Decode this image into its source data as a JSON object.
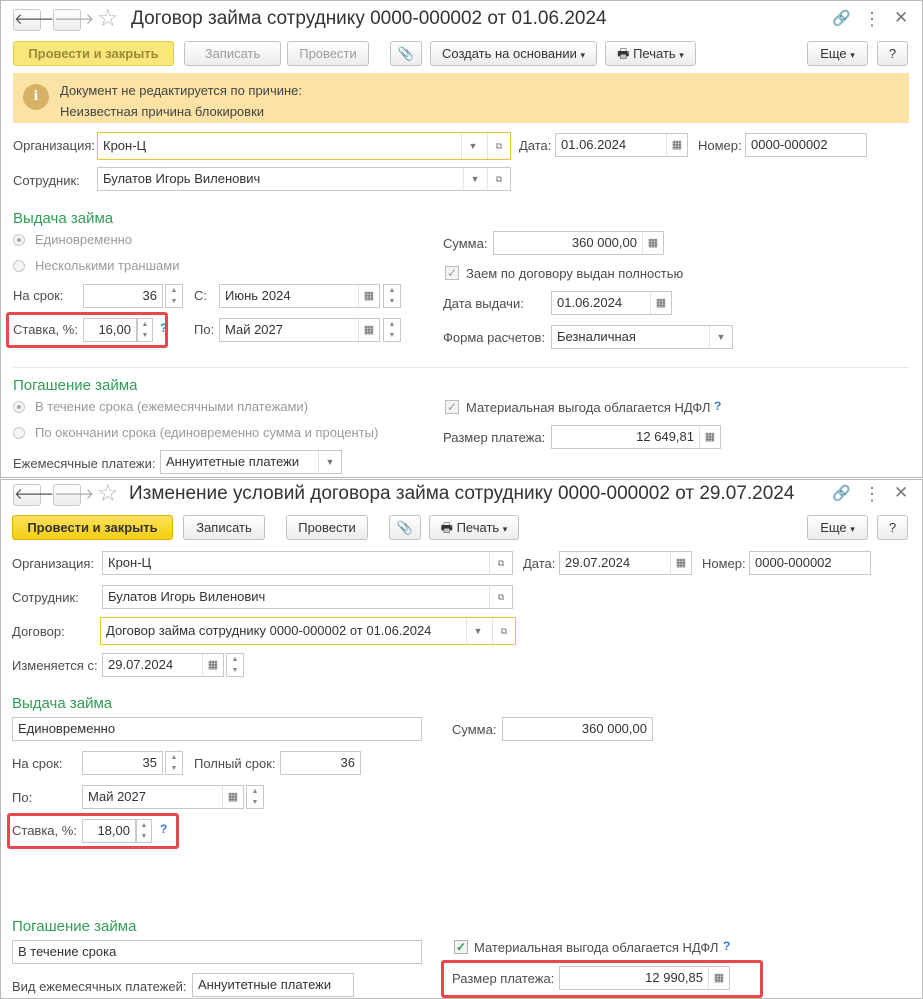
{
  "w1": {
    "title": "Договор займа сотруднику 0000-000002 от 01.06.2024",
    "nav_back": "🡐",
    "nav_fwd": "🡒",
    "toolbar": {
      "post_close": "Провести и закрыть",
      "save": "Записать",
      "post": "Провести",
      "create_based": "Создать на основании",
      "print": "Печать",
      "more": "Еще",
      "help": "?"
    },
    "banner": {
      "line1": "Документ не редактируется по причине:",
      "line2": "Неизвестная причина блокировки"
    },
    "org_label": "Организация:",
    "org_value": "Крон-Ц",
    "date_label": "Дата:",
    "date_value": "01.06.2024",
    "number_label": "Номер:",
    "number_value": "0000-000002",
    "employee_label": "Сотрудник:",
    "employee_value": "Булатов Игорь Виленович",
    "issue_section": "Выдача займа",
    "radio_once": "Единовременно",
    "radio_tranches": "Несколькими траншами",
    "term_label": "На срок:",
    "term_value": "36",
    "from_label": "С:",
    "from_value": "Июнь 2024",
    "to_label": "По:",
    "to_value": "Май 2027",
    "rate_label": "Ставка, %:",
    "rate_value": "16,00",
    "help_q": "?",
    "sum_label": "Сумма:",
    "sum_value": "360 000,00",
    "fully_issued": "Заем по договору выдан полностью",
    "issue_date_label": "Дата выдачи:",
    "issue_date_value": "01.06.2024",
    "payment_form_label": "Форма расчетов:",
    "payment_form_value": "Безналичная",
    "repay_section": "Погашение займа",
    "radio_monthly": "В течение срока (ежемесячными платежами)",
    "radio_end": "По окончании срока (единовременно сумма и проценты)",
    "ndfl_label": "Материальная выгода облагается НДФЛ",
    "payment_size_label": "Размер платежа:",
    "payment_size_value": "12 649,81",
    "monthly_label": "Ежемесячные платежи:",
    "monthly_value": "Аннуитетные платежи"
  },
  "w2": {
    "title": "Изменение условий договора займа сотруднику 0000-000002 от 29.07.2024",
    "nav_back": "🡐",
    "nav_fwd": "🡒",
    "toolbar": {
      "post_close": "Провести и закрыть",
      "save": "Записать",
      "post": "Провести",
      "print": "Печать",
      "more": "Еще",
      "help": "?"
    },
    "org_label": "Организация:",
    "org_value": "Крон-Ц",
    "date_label": "Дата:",
    "date_value": "29.07.2024",
    "number_label": "Номер:",
    "number_value": "0000-000002",
    "employee_label": "Сотрудник:",
    "employee_value": "Булатов Игорь Виленович",
    "contract_label": "Договор:",
    "contract_value": "Договор займа сотруднику 0000-000002 от 01.06.2024",
    "changed_from_label": "Изменяется с:",
    "changed_from_value": "29.07.2024",
    "issue_section": "Выдача займа",
    "issue_kind_value": "Единовременно",
    "sum_label": "Сумма:",
    "sum_value": "360 000,00",
    "term_label": "На срок:",
    "term_value": "35",
    "full_term_label": "Полный срок:",
    "full_term_value": "36",
    "to_label": "По:",
    "to_value": "Май 2027",
    "rate_label": "Ставка, %:",
    "rate_value": "18,00",
    "help_q": "?",
    "repay_section": "Погашение займа",
    "repay_kind_value": "В течение срока",
    "ndfl_label": "Материальная выгода облагается НДФЛ",
    "payment_size_label": "Размер платежа:",
    "payment_size_value": "12 990,85",
    "monthly_label": "Вид ежемесячных платежей:",
    "monthly_value": "Аннуитетные платежи"
  },
  "colors": {
    "accent_yellow": "#f4cf12",
    "section_green": "#2f9d54",
    "highlight_red": "#e5484d",
    "banner_bg": "#fbe3a6"
  }
}
